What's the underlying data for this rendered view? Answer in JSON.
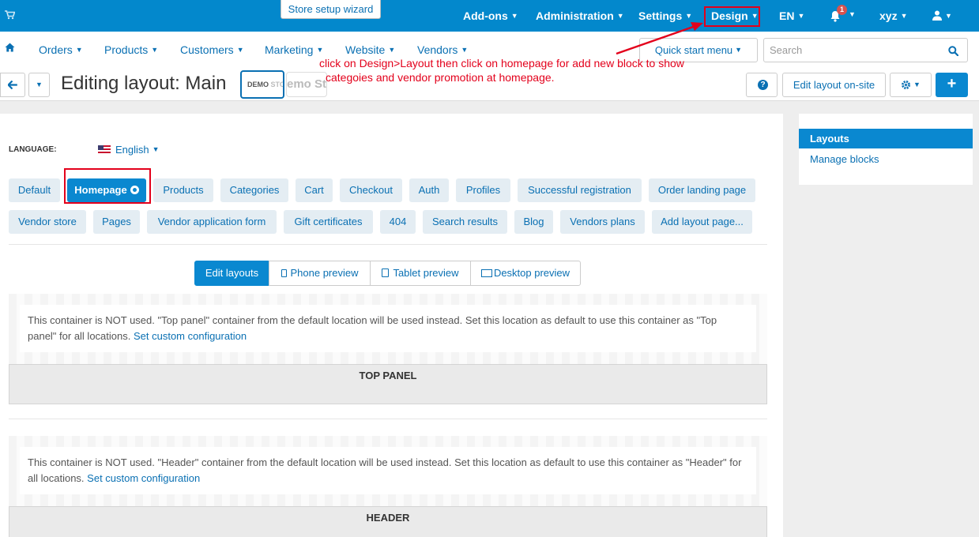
{
  "topbar": {
    "wizard_label": "Store setup wizard",
    "items": [
      {
        "label": "Add-ons"
      },
      {
        "label": "Administration"
      },
      {
        "label": "Settings"
      },
      {
        "label": "Design"
      },
      {
        "label": "EN"
      },
      {
        "label": "xyz"
      }
    ],
    "notification_count": "1"
  },
  "nav2": {
    "items": [
      {
        "label": "Orders"
      },
      {
        "label": "Products"
      },
      {
        "label": "Customers"
      },
      {
        "label": "Marketing"
      },
      {
        "label": "Website"
      },
      {
        "label": "Vendors"
      }
    ],
    "quick_start_label": "Quick start menu",
    "search_placeholder": "Search"
  },
  "annotation": {
    "line1": "click on Design>Layout then click on  homepage for add new block to show",
    "line2": "categoies and vendor promotion at homepage."
  },
  "header": {
    "title": "Editing layout: Main",
    "logo1_text": "DEMO",
    "logo1_faded": "STO",
    "logo2_text": "emo Sto",
    "edit_onsite_label": "Edit layout on-site"
  },
  "main": {
    "language_label": "LANGUAGE:",
    "language_value": "English",
    "tabs_row1": [
      "Default",
      "Homepage",
      "Products",
      "Categories",
      "Cart",
      "Checkout",
      "Auth",
      "Profiles",
      "Successful registration",
      "Order landing page"
    ],
    "tabs_row2": [
      "Vendor store",
      "Pages",
      "Vendor application form",
      "Gift certificates",
      "404",
      "Search results",
      "Blog",
      "Vendors plans",
      "Add layout page..."
    ],
    "preview_tabs": [
      "Edit layouts",
      "Phone preview",
      "Tablet preview",
      "Desktop preview"
    ],
    "containers": [
      {
        "notice": "This container is NOT used. \"Top panel\" container from the default location will be used instead. Set this location as default to use this container as \"Top panel\" for all locations.",
        "link": "Set custom configuration",
        "title": "TOP PANEL"
      },
      {
        "notice": "This container is NOT used. \"Header\" container from the default location will be used instead. Set this location as default to use this container as \"Header\" for all locations.",
        "link": "Set custom configuration",
        "title": "HEADER"
      }
    ]
  },
  "sidebar": {
    "active_label": "Layouts",
    "item_label": "Manage blocks"
  },
  "colors": {
    "topbar": "#0388cc",
    "accent": "#0a88d0",
    "link": "#0a70b3",
    "annotation": "#e3001b"
  }
}
